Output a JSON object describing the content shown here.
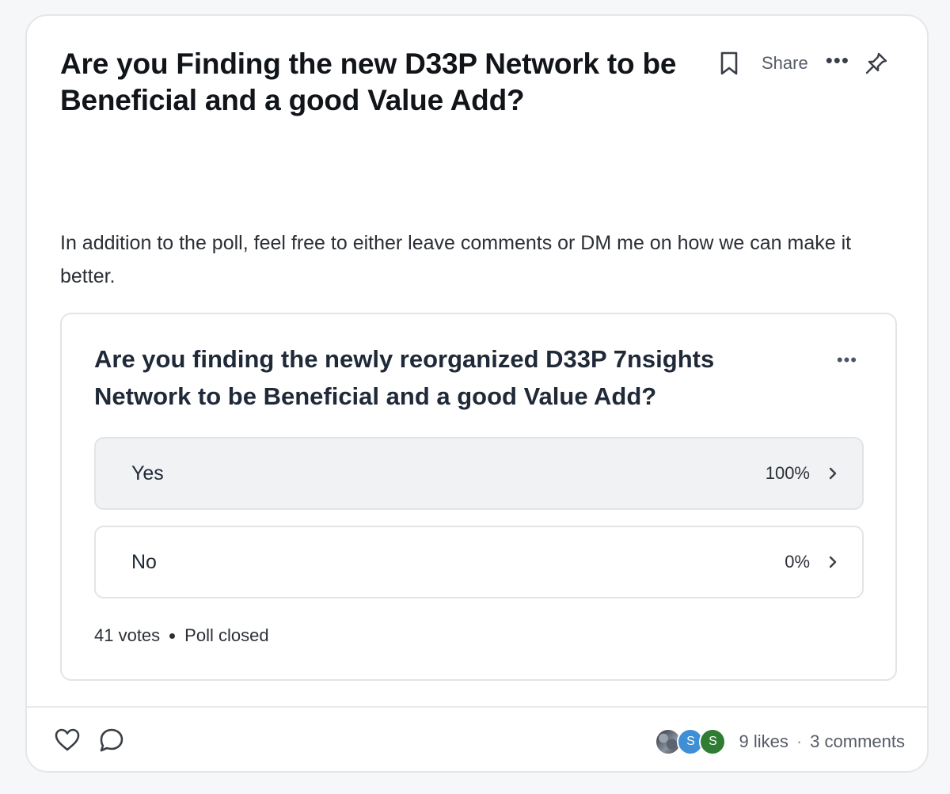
{
  "post": {
    "title": "Are you Finding the new D33P Network to be Beneficial and a good Value Add?",
    "body": "In addition to the poll, feel free to either leave comments or DM me on how we can make it better.",
    "actions": {
      "share_label": "Share",
      "more_label": "•••"
    }
  },
  "poll": {
    "question": "Are you finding the newly reorganized D33P 7nsights Network to be Beneficial and a good Value Add?",
    "menu_label": "•••",
    "options": [
      {
        "label": "Yes",
        "percent": "100%",
        "selected": true
      },
      {
        "label": "No",
        "percent": "0%",
        "selected": false
      }
    ],
    "votes": "41 votes",
    "status": "Poll closed"
  },
  "footer": {
    "avatars": [
      {
        "type": "photo",
        "letter": ""
      },
      {
        "type": "letter",
        "letter": "S",
        "color": "#3d8fd6"
      },
      {
        "type": "letter",
        "letter": "S",
        "color": "#2e7d32"
      }
    ],
    "likes": "9 likes",
    "separator": "·",
    "comments": "3 comments"
  },
  "colors": {
    "card_border": "#e4e6ea",
    "selected_option_bg": "#f1f2f4",
    "text_primary": "#1f2937",
    "text_muted": "#555b65"
  }
}
